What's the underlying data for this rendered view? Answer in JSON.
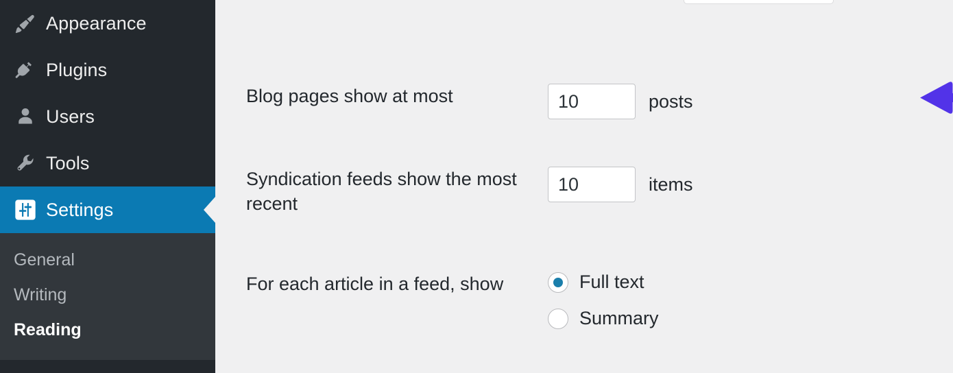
{
  "sidebar": {
    "menu_items": [
      {
        "label": "Appearance",
        "icon": "paintbrush-icon",
        "current": false
      },
      {
        "label": "Plugins",
        "icon": "plug-icon",
        "current": false
      },
      {
        "label": "Users",
        "icon": "user-icon",
        "current": false
      },
      {
        "label": "Tools",
        "icon": "wrench-icon",
        "current": false
      },
      {
        "label": "Settings",
        "icon": "sliders-icon",
        "current": true
      }
    ],
    "submenu_items": [
      {
        "label": "General",
        "current": false
      },
      {
        "label": "Writing",
        "current": false
      },
      {
        "label": "Reading",
        "current": true
      }
    ]
  },
  "main": {
    "rows": [
      {
        "label": "Blog pages show at most",
        "value": "10",
        "unit": "posts",
        "annotated": true
      },
      {
        "label": "Syndication feeds show the most recent",
        "value": "10",
        "unit": "items",
        "annotated": false
      }
    ],
    "feed_article_row": {
      "label": "For each article in a feed, show",
      "options": [
        {
          "label": "Full text",
          "selected": true
        },
        {
          "label": "Summary",
          "selected": false
        }
      ]
    }
  },
  "colors": {
    "sidebar_bg": "#23282d",
    "submenu_bg": "#32373c",
    "active_blue": "#0b7ab3",
    "content_bg": "#f0f0f1",
    "radio_dot": "#1a7eab",
    "annotation_arrow": "#5233e8",
    "text_dark": "#23282d",
    "text_muted": "#b4b9be"
  }
}
